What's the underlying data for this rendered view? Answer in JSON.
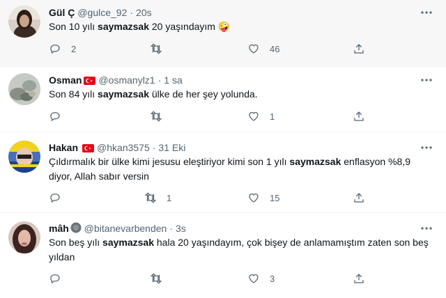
{
  "tweets": [
    {
      "name": "Gül Ç",
      "handle": "@gulce_92",
      "time": "20s",
      "text_before": "Son 10 yılı ",
      "keyword": "saymazsak",
      "text_after": " 20 yaşındayım ",
      "emoji": "🤪",
      "replies": "2",
      "retweets": "",
      "likes": "46"
    },
    {
      "name": "Osman",
      "handle": "@osmanylz1",
      "time": "1 sa",
      "text_before": "Son 84 yılı ",
      "keyword": "saymazsak",
      "text_after": " ülke de her şey yolunda.",
      "replies": "",
      "retweets": "",
      "likes": "1"
    },
    {
      "name": "Hakan",
      "handle": "@hkan3575",
      "time": "31 Eki",
      "text_before": "Çıldırmalık bir ülke kimi jesusu eleştiriyor kimi son 1 yılı ",
      "keyword": "saymazsak",
      "text_after": " enflasyon %8,9 diyor, Allah sabır versin",
      "replies": "",
      "retweets": "1",
      "likes": "15"
    },
    {
      "name": "mâh",
      "handle": "@bitanevarbenden",
      "time": "3s",
      "text_before": "Son beş yılı ",
      "keyword": "saymazsak",
      "text_after": " hala 20 yaşındayım, çok bişey de anlamamıştım zaten son beş yıldan",
      "replies": "",
      "retweets": "",
      "likes": "3"
    }
  ],
  "separator": "·",
  "colors": {
    "text": "#0f1419",
    "secondary": "#536471",
    "hover_bg": "#f7f7f7",
    "border": "#eff3f4",
    "flag_red": "#e30a17"
  },
  "icons": [
    "more-icon",
    "reply-icon",
    "retweet-icon",
    "like-icon",
    "share-icon",
    "turkey-flag-icon"
  ]
}
